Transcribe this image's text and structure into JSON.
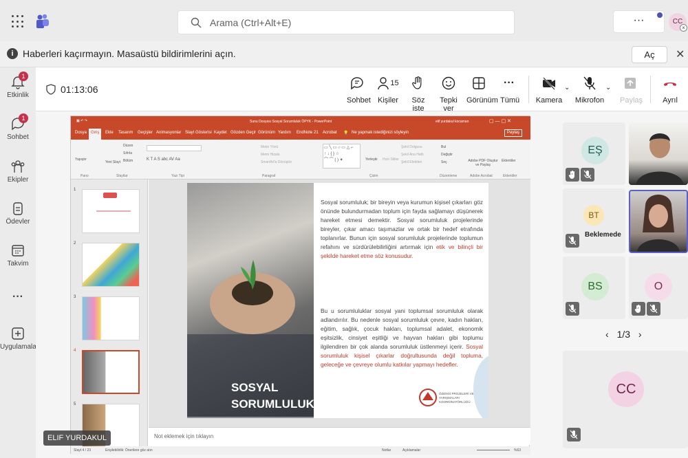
{
  "search": {
    "placeholder": "Arama (Ctrl+Alt+E)"
  },
  "top": {
    "more_label": "···",
    "avatar": "CC"
  },
  "notification": {
    "text": "Haberleri kaçırmayın. Masaüstü bildirimlerini açın.",
    "button": "Aç",
    "close": "✕"
  },
  "rail": {
    "items": [
      {
        "label": "Etkinlik",
        "badge": "1"
      },
      {
        "label": "Sohbet",
        "badge": "1"
      },
      {
        "label": "Ekipler"
      },
      {
        "label": "Ödevler"
      },
      {
        "label": "Takvim"
      },
      {
        "label": "···"
      },
      {
        "label": "Uygulamalar"
      }
    ]
  },
  "meeting": {
    "timer": "01:13:06",
    "toolbar": {
      "chat": "Sohbet",
      "people": "Kişiler",
      "people_count": "15",
      "raise_hand": "Söz iste",
      "react": "Tepki ver",
      "view": "Görünüm",
      "more_dots": "···",
      "more": "Tümü",
      "camera": "Kamera",
      "mic": "Mikrofon",
      "share": "Paylaş",
      "leave": "Ayrıl"
    }
  },
  "powerpoint": {
    "title": "Sunu Dosyası Sosyal Sorumluluk ÖPYK  -  PowerPoint",
    "user": "elif yurdakul kocaman",
    "tabs": [
      "Dosya",
      "Giriş",
      "Ekle",
      "Tasarım",
      "Geçişler",
      "Animasyonlar",
      "Slayt Gösterisi",
      "Kaydet",
      "Gözden Geçir",
      "Görünüm",
      "Yardım",
      "EndNote 21",
      "Acrobat"
    ],
    "tell_me": "Ne yapmak istediğinizi söyleyin",
    "share": "Paylaş",
    "ribbon_groups": [
      "Pano",
      "Slaytlar",
      "Yazı Tipi",
      "Paragraf",
      "Çizim",
      "Düzenleme",
      "Adobe Acrobat",
      "Eklentiler"
    ],
    "ribbon_items": {
      "paste": "Yapıştır",
      "new_slide": "Yeni Slayt",
      "layout": "Düzen",
      "reset": "Sıfırla",
      "section": "Bölüm",
      "find": "Bul",
      "replace": "Değiştir",
      "select": "Seç",
      "arrange": "Yerleştir",
      "quick_styles": "Hızlı Stiller",
      "shape_fill": "Şekil Dolgusu",
      "shape_outline": "Şekil Ana Hattı",
      "shape_effects": "Şekil Efektleri",
      "text_direction": "Metin Yönü",
      "align_text": "Metni Hizala",
      "smartart": "SmartArt'a Dönüştür",
      "adobe_pdf": "Adobe PDF Oluştur ve Paylaş",
      "addins": "Eklentiler"
    },
    "thumb_numbers": [
      "1",
      "2",
      "3",
      "4",
      "5"
    ],
    "slide": {
      "title": "SOSYAL SORUMLULUK?",
      "p1_plain": "Sosyal sorumluluk; bir bireyin veya kurumun kişisel çıkarları göz önünde bulundurmadan toplum için fayda sağlamayı düşünerek hareket etmesi demektir. Sosyal sorumluluk projelerinde bireyler, çıkar amacı taşımazlar ve ortak bir hedef etrafında toplanırlar. Bunun için sosyal sorumluluk projelerinde toplumun refahını ve sürdürülebilirliğini artırmak için ",
      "p1_red": "etik ve bilinçli bir şekilde hareket etme söz konusudur.",
      "p2_plain": "Bu u sorumluluklar sosyal yani toplumsal sorumluluk olarak adlandırılır. Bu nedenle sosyal sorumluluk çevre, kadın hakları, eğitim, sağlık, çocuk hakları, toplumsal adalet, ekonomik eşitsizlik, cinsiyet eşitliği ve hayvan hakları gibi toplumu ilgilendiren bir çok alanda sorumluluk üstlenmeyi içerir. ",
      "p2_red": "Sosyal sorumluluk kişisel çıkarlar doğrultusunda değil topluma, geleceğe ve çevreye olumlu katkılar yapmayı hedefler.",
      "logo_text": "ÖZENGİ PROJELERİ VE YARIŞMALARI KOORDİNATÖRLÜĞÜ"
    },
    "notes_placeholder": "Not eklemek için tıklayın",
    "status": {
      "slide": "Slayt 4 / 23",
      "accessibility": "Erişilebilirlik: Önerilere göz atın",
      "notes": "Notlar",
      "comments": "Açıklamalar",
      "zoom": "%63"
    }
  },
  "speaker": "ELIF YURDAKUL",
  "participants": {
    "tiles": [
      {
        "initials": "EŞ",
        "color": "#cfe8e4",
        "text_color": "#1e5d56"
      },
      {
        "initials": "BT",
        "color": "#fbe6b6",
        "text_color": "#7a5a12",
        "status": "Beklemede"
      },
      {
        "initials": "BS",
        "color": "#d3ecd3",
        "text_color": "#2e6b2e"
      },
      {
        "initials": "O",
        "color": "#f6dbe8",
        "text_color": "#7a2d52"
      }
    ],
    "self": {
      "initials": "CC",
      "color": "#f3d3e3",
      "text_color": "#6b2a4d"
    },
    "pager": "1/3"
  }
}
